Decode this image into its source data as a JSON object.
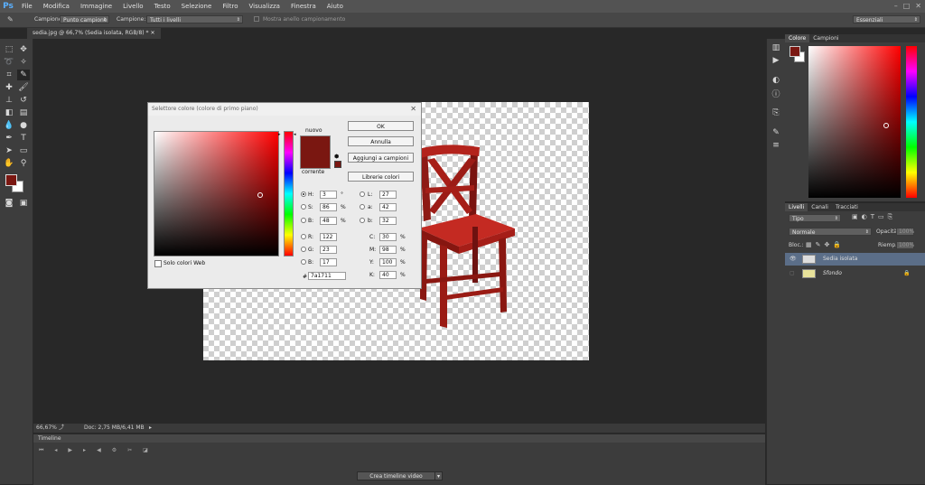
{
  "app": {
    "logo": "Ps"
  },
  "menu": [
    "File",
    "Modifica",
    "Immagine",
    "Livello",
    "Testo",
    "Selezione",
    "Filtro",
    "Visualizza",
    "Finestra",
    "Aiuto"
  ],
  "window_controls": [
    "–",
    "□",
    "✕"
  ],
  "options": {
    "campione_label": "Campione:",
    "campione_value": "Punto campione",
    "campione2_label": "Campione:",
    "campione2_value": "Tutti i livelli",
    "ring_label": "Mostra anello campionamento",
    "workspace": "Essenziali"
  },
  "doc_tab": "sedia.jpg @ 66,7% (Sedia isolata, RGB/8) *",
  "status": {
    "zoom": "66,67%",
    "doc": "Doc: 2,75 MB/6,41 MB"
  },
  "timeline": {
    "title": "Timeline",
    "create_button": "Crea timeline video"
  },
  "color_panel": {
    "tabs": [
      "Colore",
      "Campioni"
    ]
  },
  "layers_panel": {
    "tabs": [
      "Livelli",
      "Canali",
      "Tracciati"
    ],
    "filter": "Tipo",
    "blend_mode": "Normale",
    "opacity_label": "Opacità:",
    "opacity_value": "100%",
    "lock_label": "Bloc.:",
    "fill_label": "Riemp.:",
    "fill_value": "100%",
    "layers": [
      {
        "name": "Sedia isolata",
        "selected": true
      },
      {
        "name": "Sfondo",
        "selected": false
      }
    ]
  },
  "dialog": {
    "title": "Selettore colore (colore di primo piano)",
    "new_label": "nuovo",
    "current_label": "corrente",
    "buttons": {
      "ok": "OK",
      "cancel": "Annulla",
      "add_swatch": "Aggiungi a campioni",
      "libraries": "Librerie colori"
    },
    "web_only": "Solo colori Web",
    "new_color": "#7a1711",
    "current_color": "#7a1711",
    "fields_left": [
      {
        "label": "H:",
        "value": "3",
        "unit": "°",
        "checked": true
      },
      {
        "label": "S:",
        "value": "86",
        "unit": "%",
        "checked": false
      },
      {
        "label": "B:",
        "value": "48",
        "unit": "%",
        "checked": false
      },
      {
        "label": "R:",
        "value": "122",
        "unit": "",
        "checked": false
      },
      {
        "label": "G:",
        "value": "23",
        "unit": "",
        "checked": false
      },
      {
        "label": "B:",
        "value": "17",
        "unit": "",
        "checked": false
      }
    ],
    "fields_lab": [
      {
        "label": "L:",
        "value": "27"
      },
      {
        "label": "a:",
        "value": "42"
      },
      {
        "label": "b:",
        "value": "32"
      }
    ],
    "fields_cmyk": [
      {
        "label": "C:",
        "value": "30",
        "unit": "%"
      },
      {
        "label": "M:",
        "value": "98",
        "unit": "%"
      },
      {
        "label": "Y:",
        "value": "100",
        "unit": "%"
      },
      {
        "label": "K:",
        "value": "40",
        "unit": "%"
      }
    ],
    "hex_label": "#",
    "hex_value": "7a1711"
  }
}
